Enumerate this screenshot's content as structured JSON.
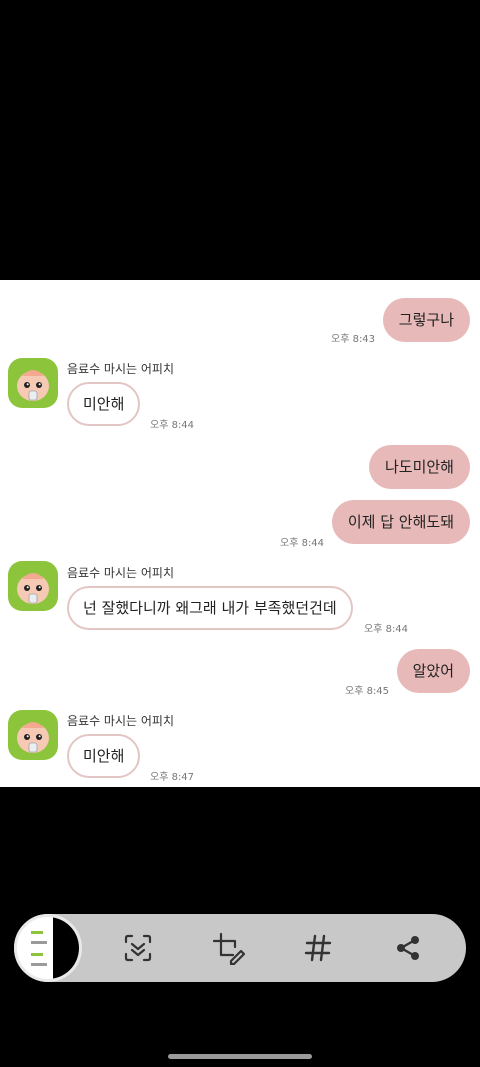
{
  "messages": {
    "out1": {
      "text": "그렇구나",
      "time": "오후 8:43"
    },
    "in1": {
      "sender": "음료수 마시는 어피치",
      "text": "미안해",
      "time": "오후 8:44"
    },
    "out2a": {
      "text": "나도미안해"
    },
    "out2b": {
      "text": "이제 답 안해도돼",
      "time": "오후 8:44"
    },
    "in2": {
      "sender": "음료수 마시는 어피치",
      "text": "넌 잘했다니까 왜그래 내가 부족했던건데",
      "time": "오후 8:44"
    },
    "out3": {
      "text": "알았어",
      "time": "오후 8:45"
    },
    "in3": {
      "sender": "음료수 마시는 어피치",
      "text": "미안해",
      "time": "오후 8:47"
    }
  },
  "toolbar": {
    "icons": [
      "preview-thumbnail",
      "scroll-capture-icon",
      "crop-edit-icon",
      "hashtag-icon",
      "share-icon"
    ]
  },
  "colors": {
    "out_bubble": "#e7b9b8",
    "in_border": "#e2c6c4",
    "avatar_bg": "#8cc43c"
  }
}
